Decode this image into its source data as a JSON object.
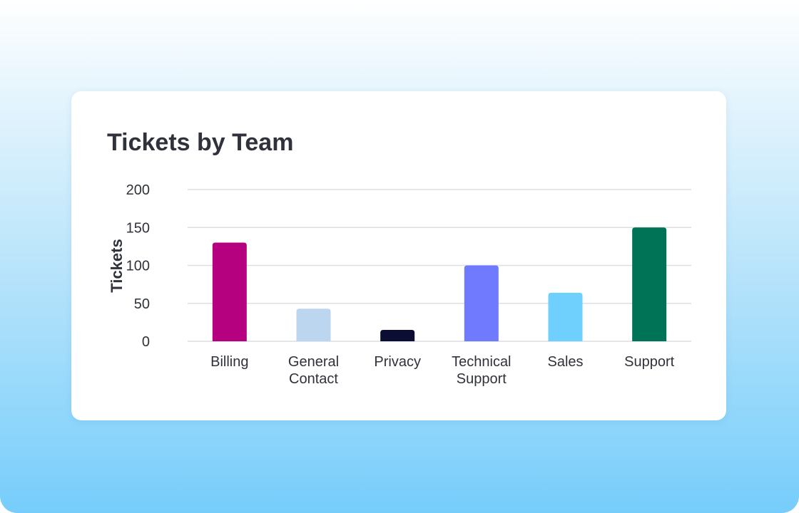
{
  "chart_data": {
    "type": "bar",
    "title": "Tickets by Team",
    "xlabel": "",
    "ylabel": "Tickets",
    "ylim": [
      0,
      200
    ],
    "yticks": [
      0,
      50,
      100,
      150,
      200
    ],
    "grid": true,
    "categories": [
      "Billing",
      "General Contact",
      "Privacy",
      "Technical Support",
      "Sales",
      "Support"
    ],
    "category_lines": [
      [
        "Billing"
      ],
      [
        "General",
        "Contact"
      ],
      [
        "Privacy"
      ],
      [
        "Technical",
        "Support"
      ],
      [
        "Sales"
      ],
      [
        "Support"
      ]
    ],
    "values": [
      130,
      43,
      15,
      100,
      64,
      150
    ],
    "colors": [
      "#b5007f",
      "#bcd6f0",
      "#0c0d33",
      "#6f7aff",
      "#6fcffd",
      "#007256"
    ]
  }
}
